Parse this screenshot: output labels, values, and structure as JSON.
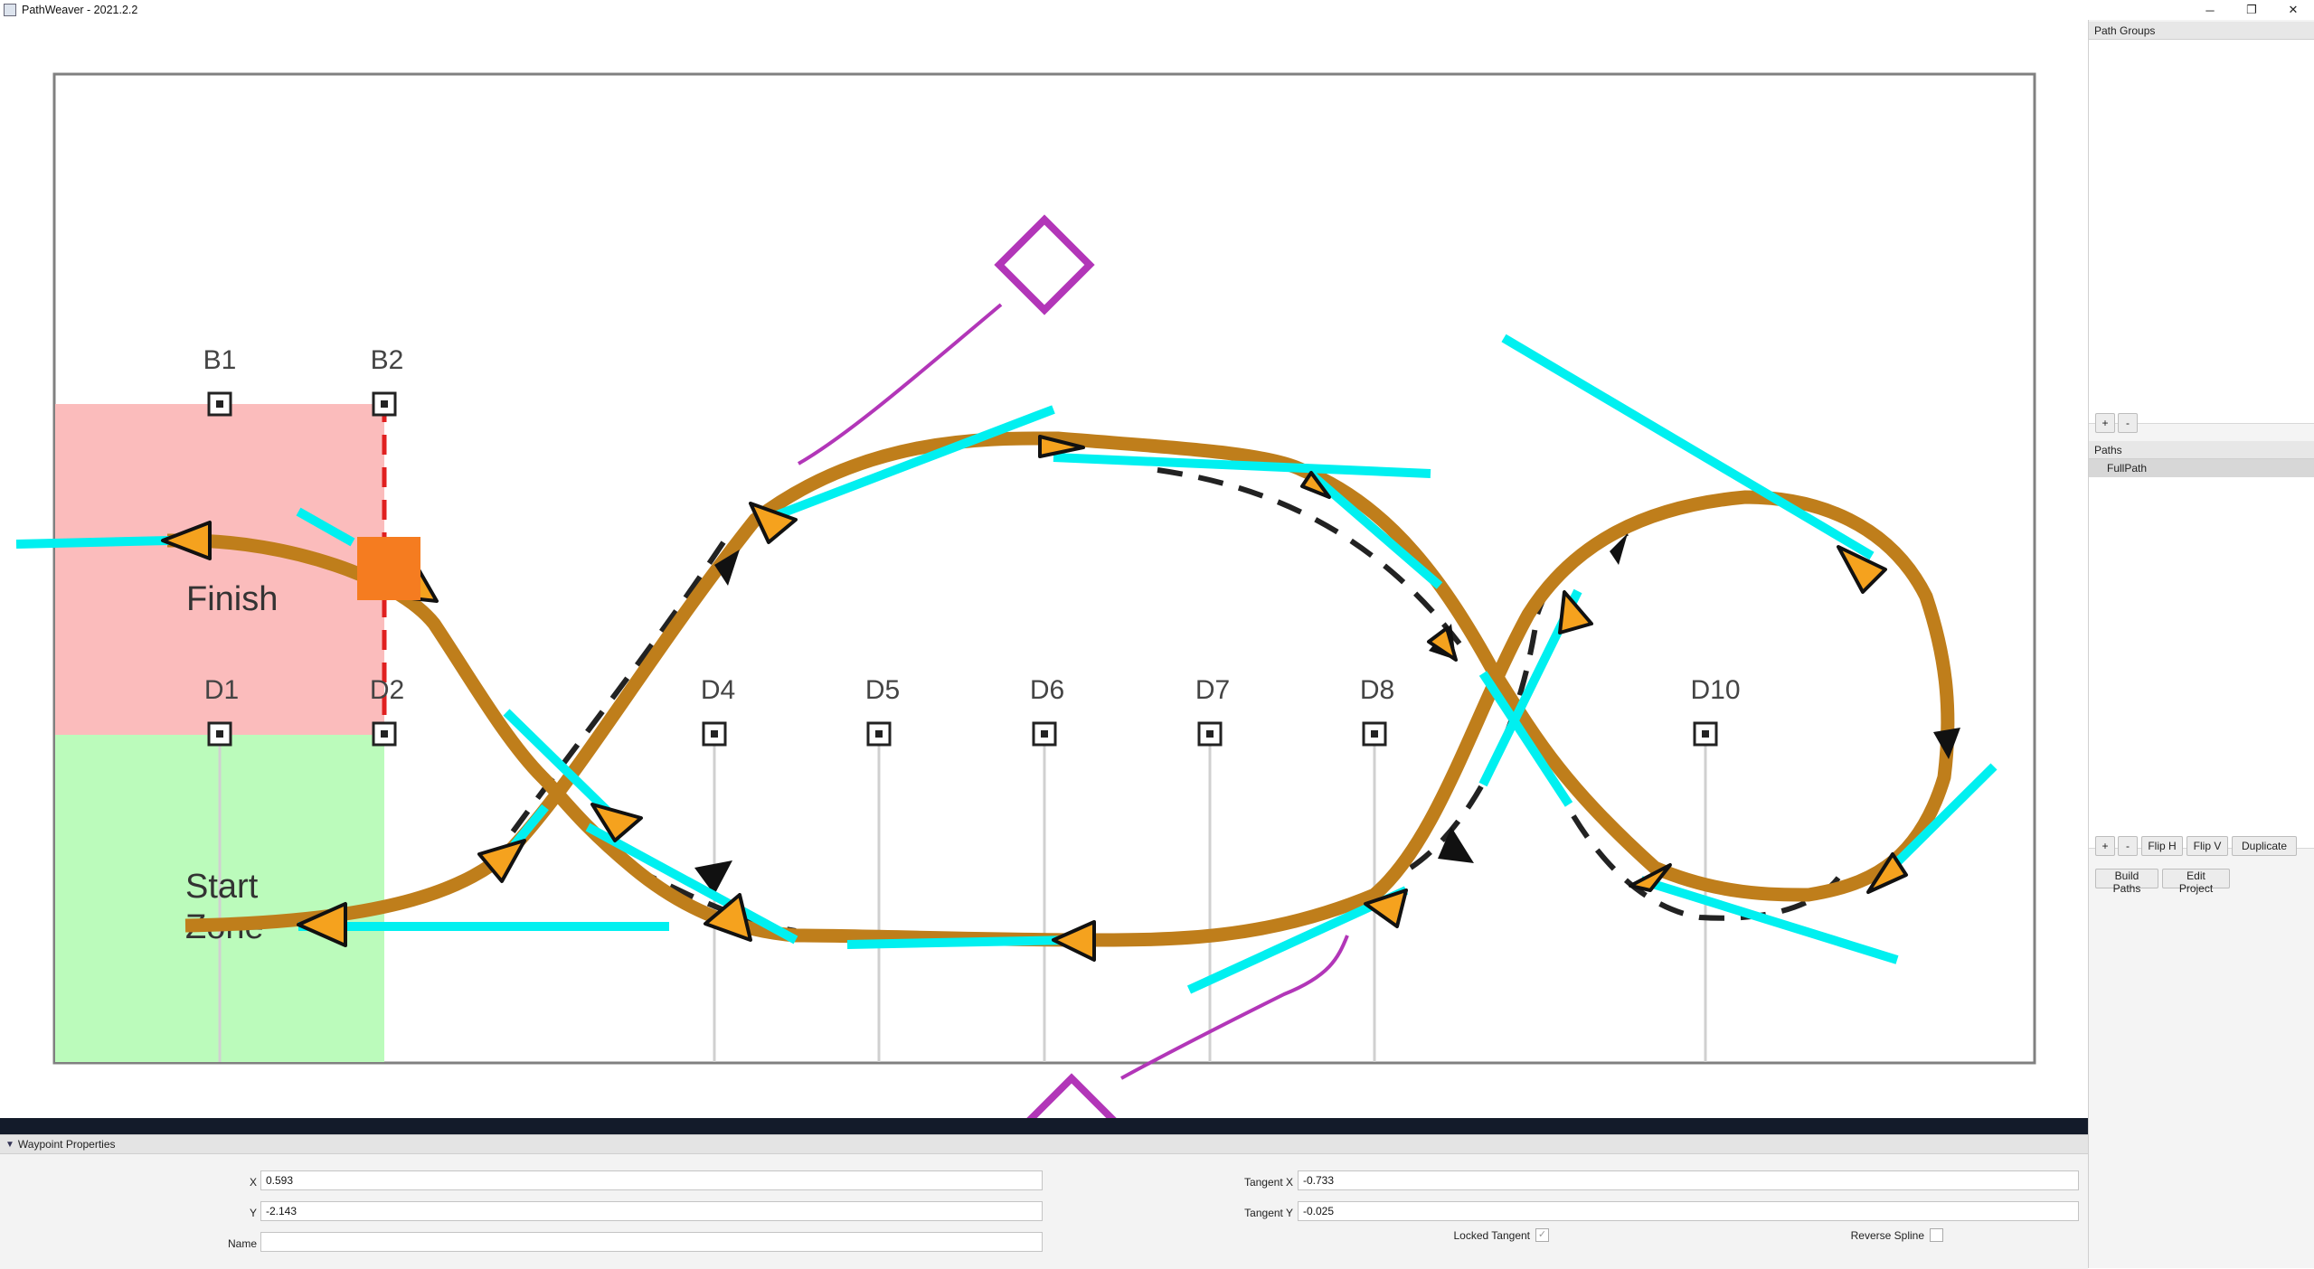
{
  "window": {
    "title": "PathWeaver - 2021.2.2",
    "controls": {
      "minimize": "─",
      "restore": "❐",
      "close": "✕"
    }
  },
  "field": {
    "zones": {
      "finish": "Finish",
      "start_line1": "Start",
      "start_line2": "Zone"
    },
    "markers": {
      "b1": "B1",
      "b2": "B2",
      "d1": "D1",
      "d2": "D2",
      "d4": "D4",
      "d5": "D5",
      "d6": "D6",
      "d7": "D7",
      "d8": "D8",
      "d10": "D10"
    },
    "colors": {
      "finish_zone": "#fbbcbc",
      "start_zone": "#bbfbbb",
      "path": "#bf7e1b",
      "waypoint": "#f5a21e",
      "selected_waypoint": "#f57c20",
      "tangent": "#00f0f0",
      "control_handle": "#b236b8",
      "boundary_line": "#e02020"
    }
  },
  "waypoint_properties": {
    "title": "Waypoint Properties",
    "x_label": "X",
    "x_value": "0.593",
    "y_label": "Y",
    "y_value": "-2.143",
    "name_label": "Name",
    "name_value": "",
    "tangent_x_label": "Tangent X",
    "tangent_x_value": "-0.733",
    "tangent_y_label": "Tangent Y",
    "tangent_y_value": "-0.025",
    "locked_tangent_label": "Locked Tangent",
    "locked_tangent_checked": true,
    "reverse_spline_label": "Reverse Spline",
    "reverse_spline_checked": false
  },
  "sidebar": {
    "path_groups_title": "Path Groups",
    "path_groups": [],
    "group_add": "+",
    "group_remove": "-",
    "paths_title": "Paths",
    "paths": [
      {
        "label": "FullPath",
        "selected": true
      }
    ],
    "path_add": "+",
    "path_remove": "-",
    "flip_h": "Flip H",
    "flip_v": "Flip V",
    "duplicate": "Duplicate",
    "build_paths": "Build Paths",
    "edit_project": "Edit Project"
  }
}
